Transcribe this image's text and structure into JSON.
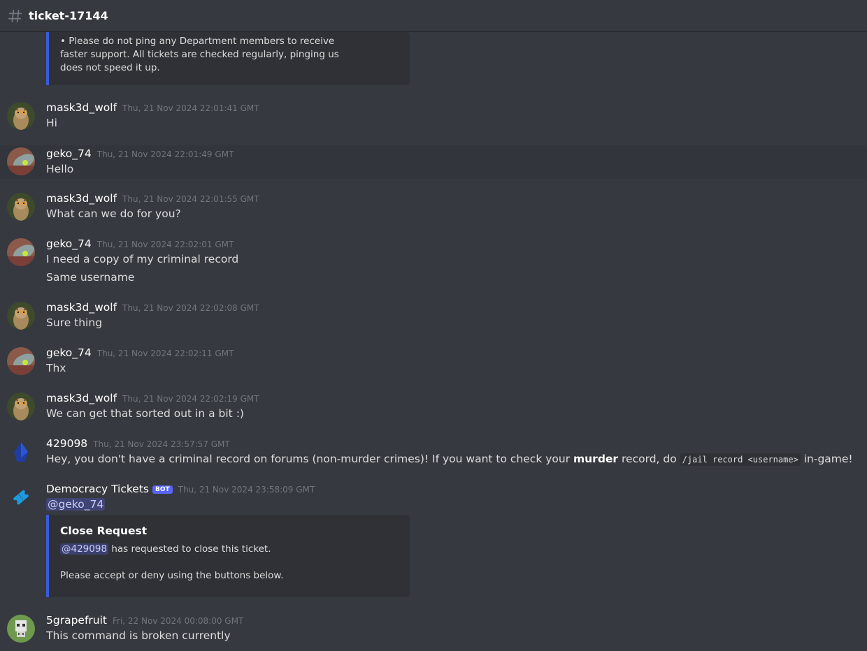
{
  "channel": {
    "name": "ticket-17144",
    "icon": "hash-icon"
  },
  "top_embed": {
    "lines": [
      "• Please do not ping any Department members to receive",
      "faster support. All tickets are checked regularly, pinging us",
      "does not speed it up."
    ]
  },
  "messages": [
    {
      "author": "mask3d_wolf",
      "timestamp": "Thu, 21 Nov 2024 22:01:41 GMT",
      "lines": [
        "Hi"
      ]
    },
    {
      "author": "geko_74",
      "timestamp": "Thu, 21 Nov 2024 22:01:49 GMT",
      "lines": [
        "Hello"
      ]
    },
    {
      "author": "mask3d_wolf",
      "timestamp": "Thu, 21 Nov 2024 22:01:55 GMT",
      "lines": [
        "What can we do for you?"
      ]
    },
    {
      "author": "geko_74",
      "timestamp": "Thu, 21 Nov 2024 22:02:01 GMT",
      "lines": [
        "I need a copy of my criminal record",
        "Same username"
      ]
    },
    {
      "author": "mask3d_wolf",
      "timestamp": "Thu, 21 Nov 2024 22:02:08 GMT",
      "lines": [
        "Sure thing"
      ]
    },
    {
      "author": "geko_74",
      "timestamp": "Thu, 21 Nov 2024 22:02:11 GMT",
      "lines": [
        "Thx"
      ]
    },
    {
      "author": "mask3d_wolf",
      "timestamp": "Thu, 21 Nov 2024 22:02:19 GMT",
      "lines": [
        "We can get that sorted out in a bit :)"
      ]
    },
    {
      "author": "429098",
      "timestamp": "Thu, 21 Nov 2024 23:57:57 GMT",
      "text_before": "Hey, you don't have a criminal record on forums (non-murder crimes)! If you want to check your ",
      "bold": "murder",
      "text_middle": " record, do ",
      "code": "/jail record <username>",
      "text_after": " in-game!"
    },
    {
      "author": "Democracy Tickets",
      "bot_tag": "BOT",
      "timestamp": "Thu, 21 Nov 2024 23:58:09 GMT",
      "mention": "@geko_74",
      "embed": {
        "title": "Close Request",
        "mention": "@429098",
        "line1": " has requested to close this ticket.",
        "line2": "Please accept or deny using the buttons below."
      }
    },
    {
      "author": "5grapefruit",
      "timestamp": "Fri, 22 Nov 2024 00:08:00 GMT",
      "lines": [
        "This command is broken currently"
      ]
    }
  ],
  "colors": {
    "background": "#36393f",
    "embed_bar": "#3b5bdb",
    "bot_tag": "#5865f2"
  }
}
